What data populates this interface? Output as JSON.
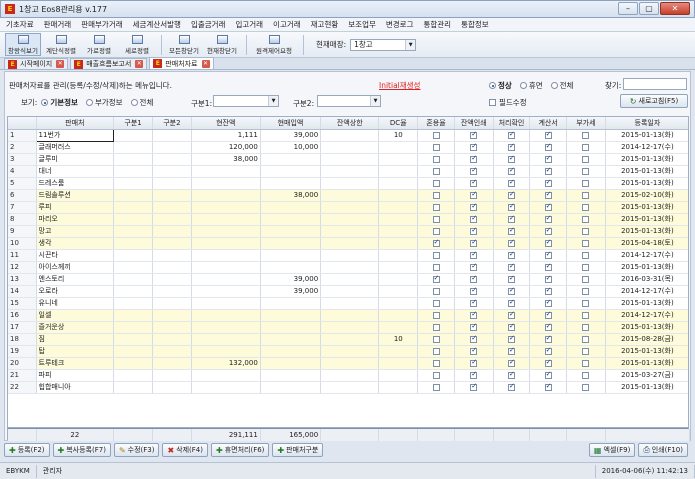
{
  "window": {
    "title": "1창고 Eos8관리용 v.177",
    "icon_letter": "E",
    "min": "–",
    "max": "▢",
    "close": "✕"
  },
  "menu": [
    "기초자료",
    "판매거래",
    "판매부가거래",
    "세금계산서발행",
    "입출금거래",
    "입고거래",
    "이고거래",
    "재고현황",
    "보조업무",
    "변경로그",
    "통합관리",
    "통합정보"
  ],
  "toolbar": {
    "buttons": [
      "창왕식보기",
      "계단식정렬",
      "가로정렬",
      "세로정렬",
      "모든창닫기",
      "현재창닫기",
      "원격제어요청"
    ],
    "store_label": "현재매장:",
    "store_value": "1창고"
  },
  "tabs": [
    {
      "label": "시작페이지",
      "active": false
    },
    {
      "label": "매출흐름보고서",
      "active": false
    },
    {
      "label": "판매처자료",
      "active": true
    }
  ],
  "filter": {
    "description": "판매처자료를 관리(등록/수정/삭제)하는 메뉴입니다.",
    "init_link": "Initial재생성",
    "status_options": [
      "정상",
      "휴면",
      "전체"
    ],
    "status_selected": "정상",
    "find_label": "찾기:",
    "view_label": "보기:",
    "view_options": [
      "기본정보",
      "부가정보",
      "전체"
    ],
    "view_selected": "기본정보",
    "gubun1_label": "구분1:",
    "gubun2_label": "구분2:",
    "required_label": "필드수정",
    "refresh_label": "새로고침(F5)"
  },
  "grid": {
    "columns": [
      "판매처",
      "구분1",
      "구분2",
      "현잔액",
      "현매입액",
      "잔액상한",
      "DC율",
      "혼용율",
      "잔액인쇄",
      "처리확인",
      "계산서",
      "부가세",
      "등록일자"
    ],
    "rows": [
      {
        "n": "1",
        "name": "11번가",
        "bal": "1,111",
        "buy": "39,000",
        "dc": "10",
        "mix": false,
        "pr": true,
        "chk": true,
        "inv": true,
        "vat": false,
        "date": "2015-01-13(화)",
        "y": false
      },
      {
        "n": "2",
        "name": "글래머러스",
        "bal": "120,000",
        "buy": "10,000",
        "dc": "",
        "mix": false,
        "pr": true,
        "chk": true,
        "inv": true,
        "vat": false,
        "date": "2014-12-17(수)",
        "y": false
      },
      {
        "n": "3",
        "name": "글루미",
        "bal": "38,000",
        "buy": "",
        "dc": "",
        "mix": false,
        "pr": true,
        "chk": true,
        "inv": true,
        "vat": false,
        "date": "2015-01-13(화)",
        "y": false
      },
      {
        "n": "4",
        "name": "대너",
        "bal": "",
        "buy": "",
        "dc": "",
        "mix": false,
        "pr": true,
        "chk": true,
        "inv": true,
        "vat": false,
        "date": "2015-01-13(화)",
        "y": false
      },
      {
        "n": "5",
        "name": "드레스룸",
        "bal": "",
        "buy": "",
        "dc": "",
        "mix": false,
        "pr": true,
        "chk": true,
        "inv": true,
        "vat": false,
        "date": "2015-01-13(화)",
        "y": false
      },
      {
        "n": "6",
        "name": "드림솔루션",
        "bal": "",
        "buy": "38,000",
        "dc": "",
        "mix": false,
        "pr": true,
        "chk": true,
        "inv": true,
        "vat": false,
        "date": "2015-02-10(화)",
        "y": true
      },
      {
        "n": "7",
        "name": "루피",
        "bal": "",
        "buy": "",
        "dc": "",
        "mix": false,
        "pr": true,
        "chk": true,
        "inv": true,
        "vat": false,
        "date": "2015-01-13(화)",
        "y": true
      },
      {
        "n": "8",
        "name": "마리오",
        "bal": "",
        "buy": "",
        "dc": "",
        "mix": false,
        "pr": true,
        "chk": true,
        "inv": true,
        "vat": false,
        "date": "2015-01-13(화)",
        "y": true
      },
      {
        "n": "9",
        "name": "망고",
        "bal": "",
        "buy": "",
        "dc": "",
        "mix": false,
        "pr": true,
        "chk": true,
        "inv": true,
        "vat": false,
        "date": "2015-01-13(화)",
        "y": true
      },
      {
        "n": "10",
        "name": "생각",
        "bal": "",
        "buy": "",
        "dc": "",
        "mix": true,
        "pr": true,
        "chk": true,
        "inv": true,
        "vat": false,
        "date": "2015-04-18(토)",
        "y": true
      },
      {
        "n": "11",
        "name": "시끈타",
        "bal": "",
        "buy": "",
        "dc": "",
        "mix": false,
        "pr": true,
        "chk": true,
        "inv": true,
        "vat": false,
        "date": "2014-12-17(수)",
        "y": false
      },
      {
        "n": "12",
        "name": "아이스께끼",
        "bal": "",
        "buy": "",
        "dc": "",
        "mix": false,
        "pr": true,
        "chk": true,
        "inv": true,
        "vat": false,
        "date": "2015-01-13(화)",
        "y": false
      },
      {
        "n": "13",
        "name": "엔스토리",
        "bal": "",
        "buy": "39,000",
        "dc": "",
        "mix": true,
        "pr": true,
        "chk": true,
        "inv": true,
        "vat": false,
        "date": "2016-03-31(목)",
        "y": false
      },
      {
        "n": "14",
        "name": "오로라",
        "bal": "",
        "buy": "39,000",
        "dc": "",
        "mix": false,
        "pr": true,
        "chk": true,
        "inv": true,
        "vat": false,
        "date": "2014-12-17(수)",
        "y": false
      },
      {
        "n": "15",
        "name": "유니네",
        "bal": "",
        "buy": "",
        "dc": "",
        "mix": false,
        "pr": true,
        "chk": true,
        "inv": true,
        "vat": false,
        "date": "2015-01-13(화)",
        "y": false
      },
      {
        "n": "16",
        "name": "일셀",
        "bal": "",
        "buy": "",
        "dc": "",
        "mix": false,
        "pr": true,
        "chk": true,
        "inv": true,
        "vat": false,
        "date": "2014-12-17(수)",
        "y": true
      },
      {
        "n": "17",
        "name": "즐거운상",
        "bal": "",
        "buy": "",
        "dc": "",
        "mix": false,
        "pr": true,
        "chk": true,
        "inv": true,
        "vat": false,
        "date": "2015-01-13(화)",
        "y": true
      },
      {
        "n": "18",
        "name": "짐",
        "bal": "",
        "buy": "",
        "dc": "10",
        "mix": false,
        "pr": true,
        "chk": true,
        "inv": true,
        "vat": false,
        "date": "2015-08-28(금)",
        "y": true
      },
      {
        "n": "19",
        "name": "탑",
        "bal": "",
        "buy": "",
        "dc": "",
        "mix": false,
        "pr": true,
        "chk": true,
        "inv": true,
        "vat": false,
        "date": "2015-01-13(화)",
        "y": true
      },
      {
        "n": "20",
        "name": "트루테크",
        "bal": "132,000",
        "buy": "",
        "dc": "",
        "mix": false,
        "pr": true,
        "chk": true,
        "inv": true,
        "vat": false,
        "date": "2015-01-13(화)",
        "y": true
      },
      {
        "n": "21",
        "name": "파피",
        "bal": "",
        "buy": "",
        "dc": "",
        "mix": false,
        "pr": true,
        "chk": true,
        "inv": true,
        "vat": false,
        "date": "2015-03-27(금)",
        "y": false
      },
      {
        "n": "22",
        "name": "힙합매니아",
        "bal": "",
        "buy": "",
        "dc": "",
        "mix": false,
        "pr": true,
        "chk": true,
        "inv": true,
        "vat": false,
        "date": "2015-01-13(화)",
        "y": false
      }
    ],
    "footer": {
      "count": "22",
      "bal_total": "291,111",
      "buy_total": "165,000"
    }
  },
  "actions": {
    "left": [
      "등록(F2)",
      "복사등록(F7)",
      "수정(F3)",
      "삭제(F4)",
      "휴면처리(F6)",
      "판매처구분"
    ],
    "right": [
      "엑셀(F9)",
      "인쇄(F10)"
    ]
  },
  "status": {
    "user_code": "EBYKM",
    "role": "관리자",
    "datetime": "2016-04-06(수) 11:42:13"
  },
  "colors": {
    "row_highlight": "#fdfbd9",
    "link_red": "#e02020",
    "brand_red": "#c8281e"
  }
}
